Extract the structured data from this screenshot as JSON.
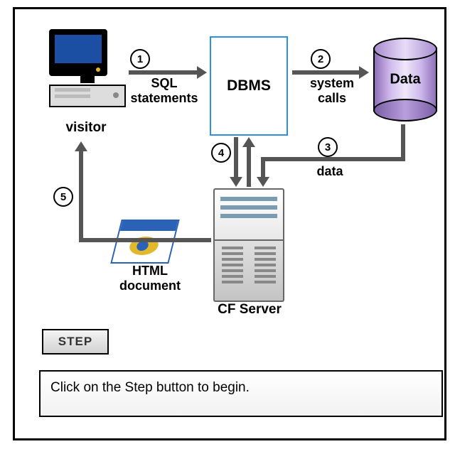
{
  "nodes": {
    "visitor": {
      "label": "visitor"
    },
    "dbms": {
      "label": "DBMS"
    },
    "data": {
      "label": "Data"
    },
    "cfserver": {
      "label": "CF Server"
    },
    "htmldoc": {
      "label_line1": "HTML",
      "label_line2": "document"
    }
  },
  "arrows": [
    {
      "num": "1",
      "from": "visitor",
      "to": "dbms",
      "label_line1": "SQL",
      "label_line2": "statements"
    },
    {
      "num": "2",
      "from": "dbms",
      "to": "data",
      "label_line1": "system",
      "label_line2": "calls"
    },
    {
      "num": "3",
      "from": "data",
      "to": "cfserver",
      "label": "data"
    },
    {
      "num": "4",
      "from": "cfserver",
      "to": "dbms",
      "label": ""
    },
    {
      "num": "5",
      "from": "cfserver",
      "to": "visitor",
      "via": "htmldoc",
      "label": ""
    }
  ],
  "controls": {
    "step_button": "STEP",
    "instruction": "Click on the Step button to begin."
  }
}
